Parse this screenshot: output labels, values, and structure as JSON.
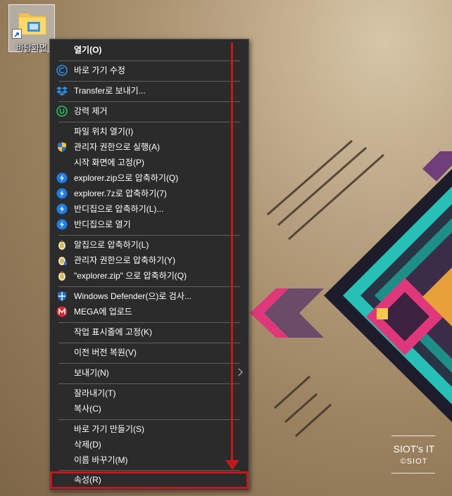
{
  "desktop": {
    "icon_label": "바탕화면"
  },
  "menu": {
    "items": [
      {
        "label": "열기(O)",
        "icon": "none"
      },
      {
        "label": "바로 가기 수정",
        "icon": "ccleaner-icon"
      },
      {
        "label": "Transfer로 보내기...",
        "icon": "dropbox-icon"
      },
      {
        "label": "강력 제거",
        "icon": "uninstall-icon"
      },
      {
        "label": "파일 위치 열기(I)",
        "icon": "none"
      },
      {
        "label": "관리자 권한으로 실행(A)",
        "icon": "shield-uac-icon"
      },
      {
        "label": "시작 화면에 고정(P)",
        "icon": "none"
      },
      {
        "label": "explorer.zip으로 압축하기(Q)",
        "icon": "bandizip-icon"
      },
      {
        "label": "explorer.7z로 압축하기(7)",
        "icon": "bandizip-icon"
      },
      {
        "label": "반디집으로 압축하기(L)...",
        "icon": "bandizip-icon"
      },
      {
        "label": "반디집으로 열기",
        "icon": "bandizip-icon"
      },
      {
        "label": "알집으로 압축하기(L)",
        "icon": "alzip-icon"
      },
      {
        "label": "관리자 권한으로 압축하기(Y)",
        "icon": "alzip-icon"
      },
      {
        "label": "\"explorer.zip\" 으로 압축하기(Q)",
        "icon": "alzip-icon"
      },
      {
        "label": "Windows Defender(으)로 검사...",
        "icon": "defender-icon"
      },
      {
        "label": "MEGA에 업로드",
        "icon": "mega-icon"
      },
      {
        "label": "작업 표시줄에 고정(K)",
        "icon": "none"
      },
      {
        "label": "이전 버전 복원(V)",
        "icon": "none"
      },
      {
        "label": "보내기(N)",
        "icon": "none",
        "submenu": true
      },
      {
        "label": "잘라내기(T)",
        "icon": "none"
      },
      {
        "label": "복사(C)",
        "icon": "none"
      },
      {
        "label": "바로 가기 만들기(S)",
        "icon": "none"
      },
      {
        "label": "삭제(D)",
        "icon": "none"
      },
      {
        "label": "이름 바꾸기(M)",
        "icon": "none"
      },
      {
        "label": "속성(R)",
        "icon": "none"
      }
    ]
  },
  "watermark": {
    "title": "SIOT's IT",
    "subtitle": "©SIOT"
  },
  "colors": {
    "menu_bg": "#2b2b2b",
    "annotation": "#c51818"
  }
}
